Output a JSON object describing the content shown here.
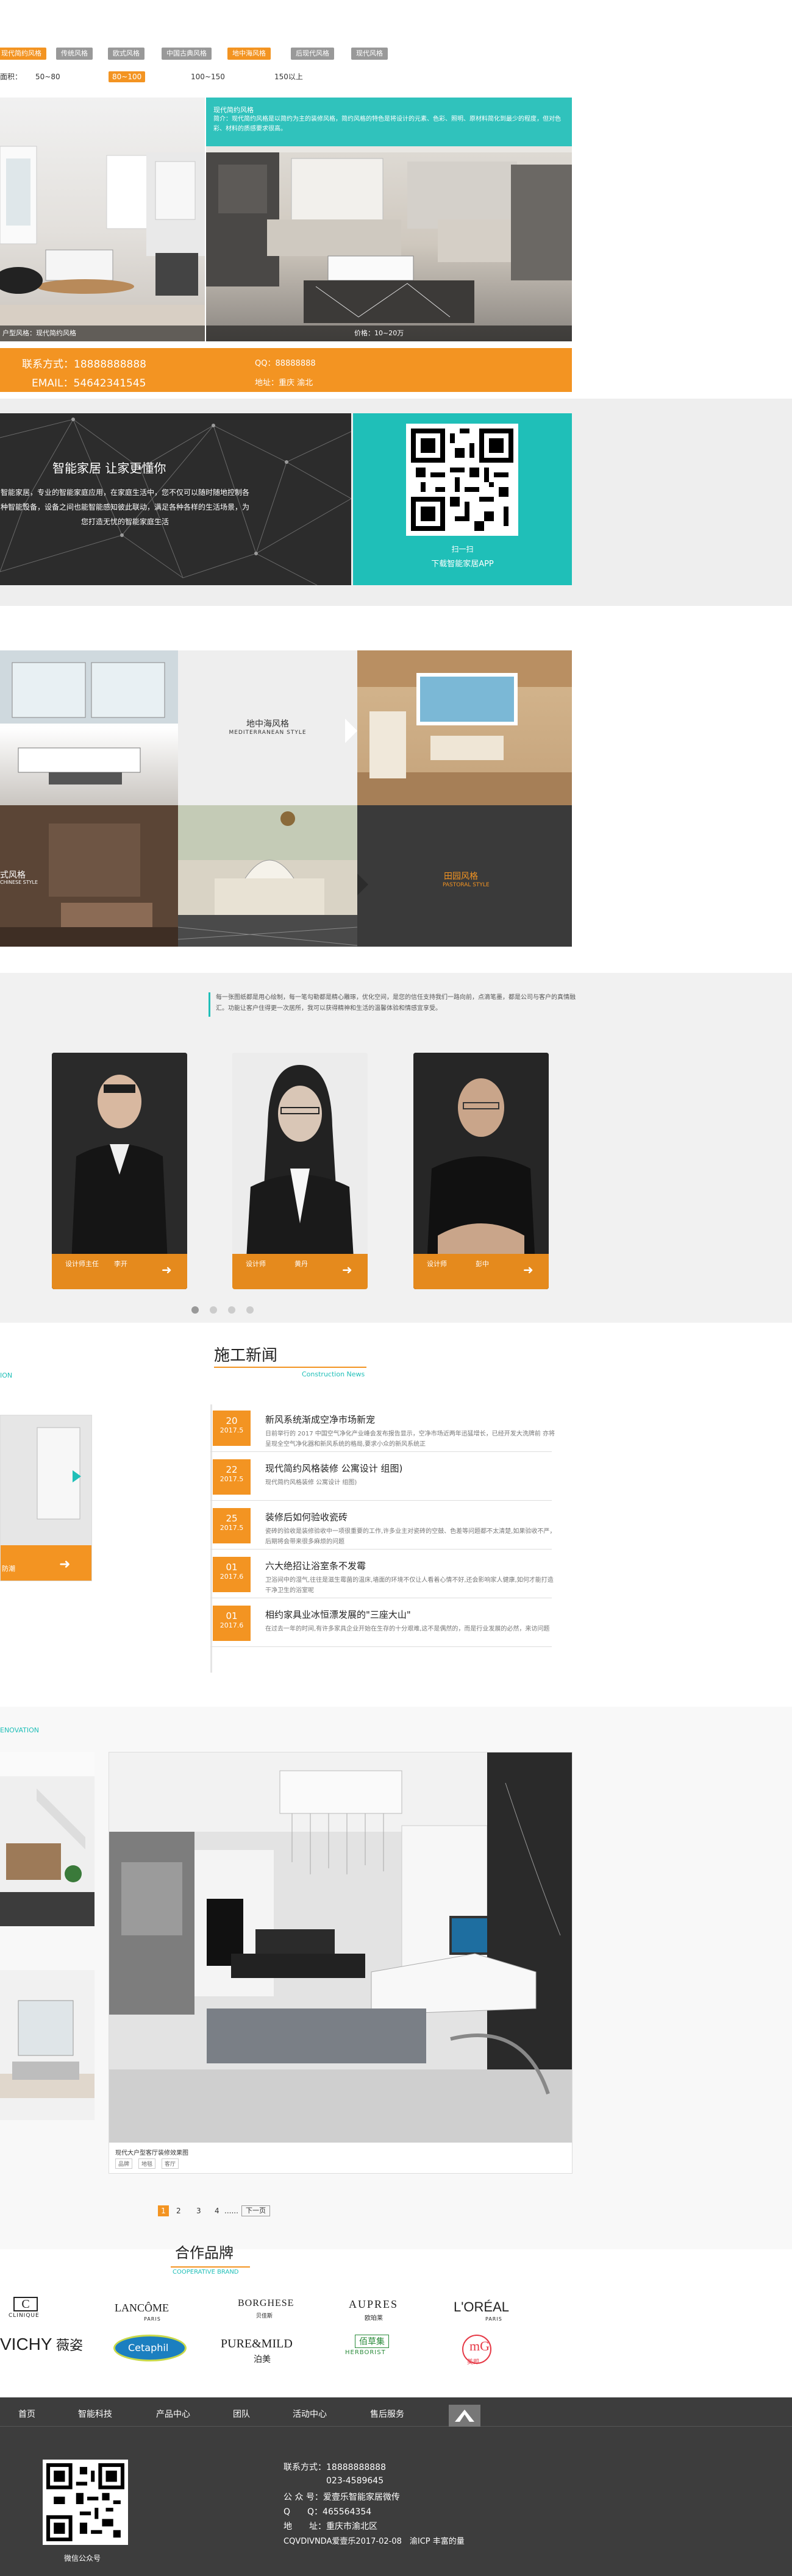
{
  "filters": {
    "styles": [
      {
        "label": "现代简约风格",
        "active": true
      },
      {
        "label": "传统风格",
        "active": false
      },
      {
        "label": "欧式风格",
        "active": false
      },
      {
        "label": "中国古典风格",
        "active": false
      },
      {
        "label": "地中海风格",
        "active": true
      },
      {
        "label": "后现代风格",
        "active": false
      },
      {
        "label": "现代风格",
        "active": false
      }
    ],
    "area_label": "面积：",
    "prices": [
      {
        "label": "50~80",
        "active": false
      },
      {
        "label": "80~100",
        "active": true
      },
      {
        "label": "100~150",
        "active": false
      },
      {
        "label": "150以上",
        "active": false
      }
    ]
  },
  "feature": {
    "desc_title": "现代简约风格",
    "desc_text": "简介：现代简约风格是以简约为主的装修风格，简约风格的特色是将设计的元素、色彩、照明、原材料简化到最少的程度，但对色彩、材料的质感要求很高。",
    "left_caption": "户型风格：现代简约风格",
    "price_caption": "价格：10~20万"
  },
  "contact": {
    "phone": "联系方式：18888888888",
    "qq": "QQ：88888888",
    "email": "EMAIL：54642341545",
    "address": "地址：重庆 渝北"
  },
  "smart": {
    "title": "智能家居  让家更懂你",
    "text": "智能家居，专业的智能家庭应用，在家庭生活中，您不仅可以随时随地控制各种智能设备，设备之间也能智能感知彼此联动，满足各种各样的生活场景，为您打造无忧的智能家庭生活",
    "qr_line1": "扫一扫",
    "qr_line2": "下载智能家居APP"
  },
  "styles_grid": {
    "med_cn": "地中海风格",
    "med_en": "MEDITERRANEAN STYLE",
    "rustic_cn": "田园风格",
    "rustic_en": "PASTORAL STYLE",
    "left_cn": "式风格",
    "left_en": "CHINESE STYLE"
  },
  "team": {
    "intro": "每一张图纸都是用心绘制，每一笔勾勒都是精心雕琢，优化空间，是您的信任支持我们一路向前，点滴笔墨，都是公司与客户的真情融汇。功能让客户住得更一次居所，我可以获得精神和生活的温馨体验和情感宜享受。",
    "members": [
      {
        "role": "设计师主任",
        "name": "李开"
      },
      {
        "role": "设计师",
        "name": "黄丹"
      },
      {
        "role": "设计师",
        "name": "彭中"
      }
    ]
  },
  "news": {
    "title": "施工新闻",
    "subtitle": "Construction News",
    "left_tag": "ION",
    "left_caption": "防潮",
    "items": [
      {
        "day": "20",
        "ym": "2017.5",
        "title": "新风系统渐成空净市场新宠",
        "summary": "日前举行的 2017 中国空气净化产业峰会发布报告显示，空净市场近两年迅猛增长，已经开发大洗牌前 亦将呈现全空气净化器和新风系统的格局,要求小众的新风系统正"
      },
      {
        "day": "22",
        "ym": "2017.5",
        "title": "现代简约风格装修 公寓设计 组图)",
        "summary": "现代简约风格装修 公寓设计 组图)"
      },
      {
        "day": "25",
        "ym": "2017.5",
        "title": "装修后如何验收瓷砖",
        "summary": "瓷砖的验收是装修验收中一项很重要的工作,许多业主对瓷砖的空鼓、色差等问题都不太清楚,如果验收不严，后期将会带来很多麻烦的问题"
      },
      {
        "day": "01",
        "ym": "2017.6",
        "title": "六大绝招让浴室条不发霉",
        "summary": "卫浴间中的湿气,往往是滋生霉菌的温床,墙面的环境不仅让人看着心情不好,还会影响家人健康,如何才能打造干净卫生的浴室呢"
      },
      {
        "day": "01",
        "ym": "2017.6",
        "title": "相约家具业冰恒漂发展的\"三座大山\"",
        "summary": "在过去一年的时间,有许多家具企业开始在生存的十分艰难,这不是偶然的，而是行业发展的必然，来访问题"
      }
    ]
  },
  "renovation": {
    "tag": "ENOVATION",
    "caption": "现代大户型客厅装修效果图",
    "chips": [
      "品牌",
      "地毯",
      "客厅"
    ],
    "pages": [
      "1",
      "2",
      "3",
      "4"
    ],
    "ellipsis": "......",
    "next": "下一页"
  },
  "partners": {
    "title": "合作品牌",
    "subtitle": "COOPERATIVE BRAND",
    "brands": {
      "clinique": "CLINIQUE",
      "lancome": "LANCÔME",
      "lancome_sub": "PARIS",
      "borghese": "BORGHESE",
      "borghese_sub": "贝佳斯",
      "aupres": "AUPRES",
      "aupres_sub": "欧珀莱",
      "loreal": "L'ORÉAL",
      "loreal_sub": "PARIS",
      "vichy": "VICHY",
      "vichy_cn": "薇姿",
      "cetaphil": "Cetaphil",
      "puremild": "PURE&MILD",
      "puremild_sub": "泊美",
      "herborist": "佰草集",
      "herborist_sub": "HERBORIST",
      "mg": "mG",
      "mg_sub": "美即"
    }
  },
  "footer": {
    "nav": [
      "首页",
      "智能科技",
      "产品中心",
      "团队",
      "活动中心",
      "售后服务"
    ],
    "wechat_label": "微信公众号",
    "info": [
      "联系方式：18888888888",
      "023-4589645",
      "公 众 号：爱壹乐智能家居微传",
      "Q　　Q：465564354",
      "地　　址：重庆市渝北区",
      "CQVDIVNDA爱壹乐2017-02-08　渝ICP 丰富的量"
    ]
  },
  "colors": {
    "accent": "#f39422",
    "teal": "#1fbfb8",
    "dark": "#3a3a3a"
  }
}
